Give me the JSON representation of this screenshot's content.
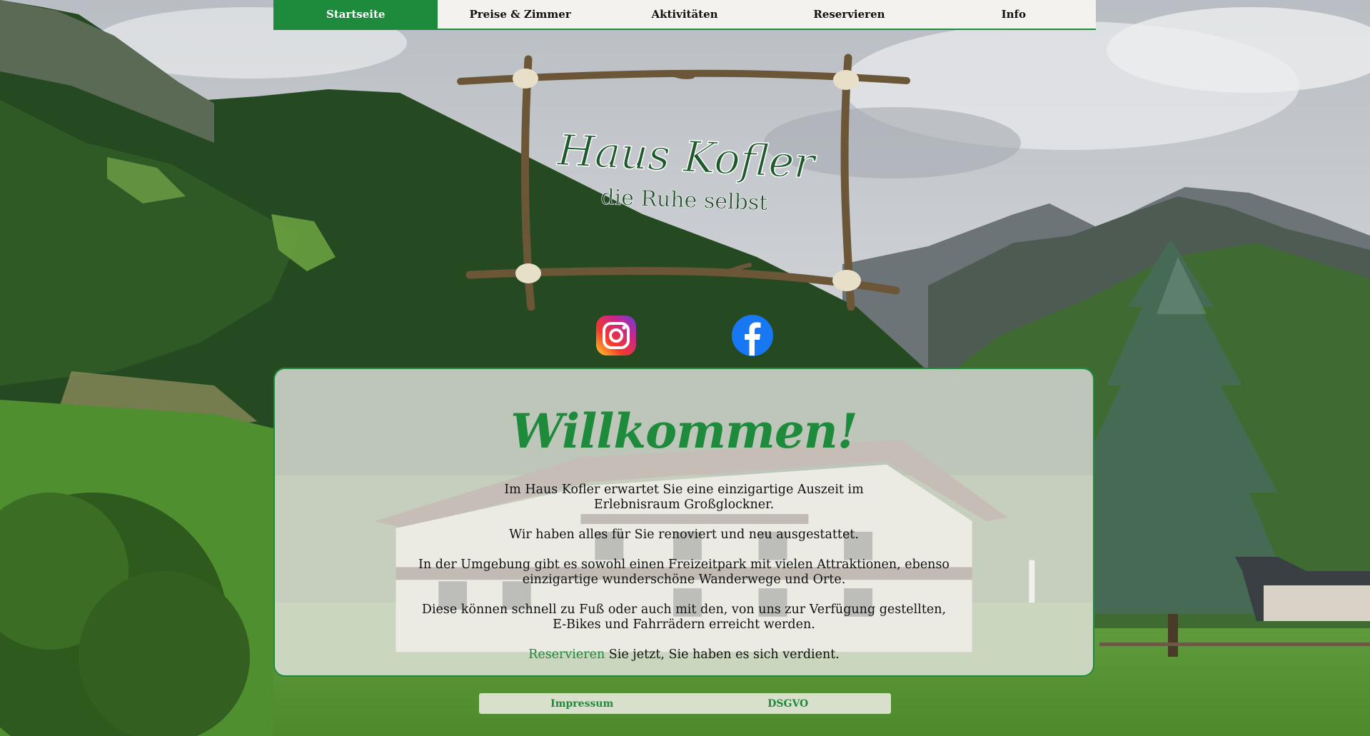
{
  "nav": {
    "items": [
      {
        "label": "Startseite",
        "active": true
      },
      {
        "label": "Preise & Zimmer",
        "active": false
      },
      {
        "label": "Aktivitäten",
        "active": false
      },
      {
        "label": "Reservieren",
        "active": false
      },
      {
        "label": "Info",
        "active": false
      }
    ]
  },
  "logo": {
    "title": "Haus Kofler",
    "subtitle": "die Ruhe selbst"
  },
  "social": {
    "instagram_icon": "instagram-icon",
    "facebook_icon": "facebook-icon"
  },
  "welcome": {
    "title": "Willkommen!",
    "p1_line1": "Im Haus Kofler erwartet Sie eine einzigartige Auszeit im",
    "p1_line2": "Erlebnisraum Großglockner.",
    "p2": "Wir haben alles für Sie renoviert und neu ausgestattet.",
    "p3_line1": "In der Umgebung gibt es sowohl einen Freizeitpark mit vielen Attraktionen, ebenso",
    "p3_line2": "einzigartige wunderschöne Wanderwege und Orte.",
    "p4_line1": "Diese können schnell zu Fuß oder auch mit den, von uns zur Verfügung gestellten,",
    "p4_line2": "E-Bikes und Fahrrädern erreicht werden.",
    "p5_link": "Reservieren",
    "p5_rest": " Sie jetzt, Sie haben es sich verdient."
  },
  "footer": {
    "impressum": "Impressum",
    "dsgvo": "DSGVO"
  },
  "colors": {
    "accent_green": "#1e8a3c",
    "nav_background": "#f4f2ef"
  }
}
